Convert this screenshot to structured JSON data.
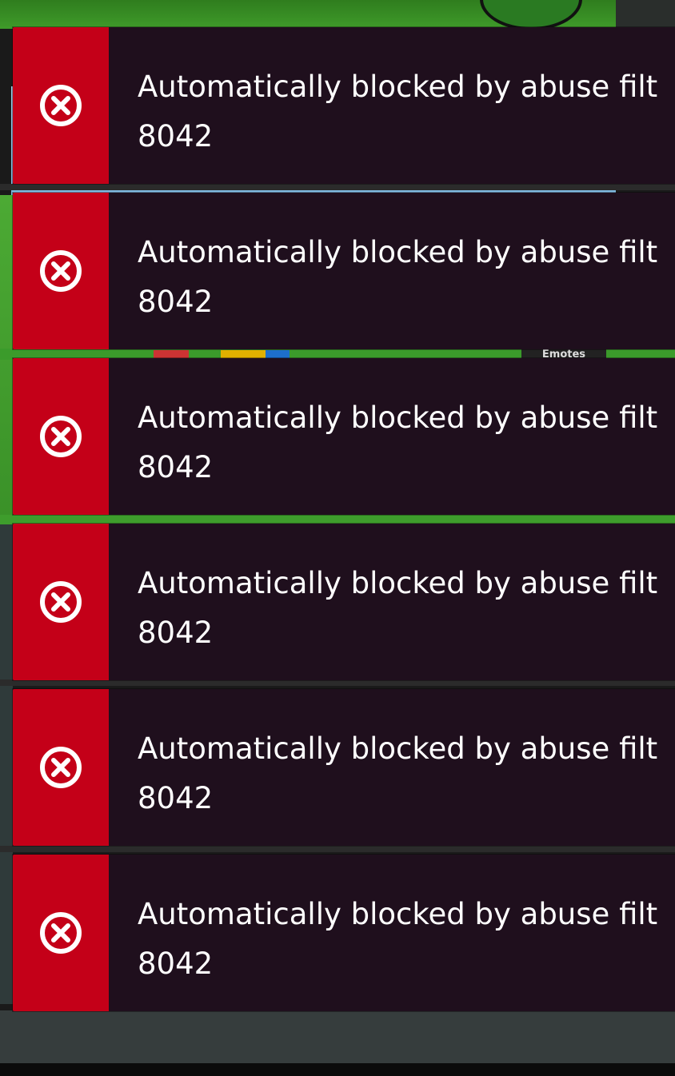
{
  "background": {
    "emotes_label": "Emotes"
  },
  "toasts": [
    {
      "icon": "error-circle-x-icon",
      "line1": "Automatically blocked by abuse filt",
      "line2": "8042"
    },
    {
      "icon": "error-circle-x-icon",
      "line1": "Automatically blocked by abuse filt",
      "line2": "8042"
    },
    {
      "icon": "error-circle-x-icon",
      "line1": "Automatically blocked by abuse filt",
      "line2": "8042"
    },
    {
      "icon": "error-circle-x-icon",
      "line1": "Automatically blocked by abuse filt",
      "line2": "8042"
    },
    {
      "icon": "error-circle-x-icon",
      "line1": "Automatically blocked by abuse filt",
      "line2": "8042"
    },
    {
      "icon": "error-circle-x-icon",
      "line1": "Automatically blocked by abuse filt",
      "line2": "8042"
    }
  ],
  "colors": {
    "toast_icon_bg": "#c40018",
    "toast_body_bg": "#1f0f1d",
    "toast_text": "#ffffff"
  }
}
